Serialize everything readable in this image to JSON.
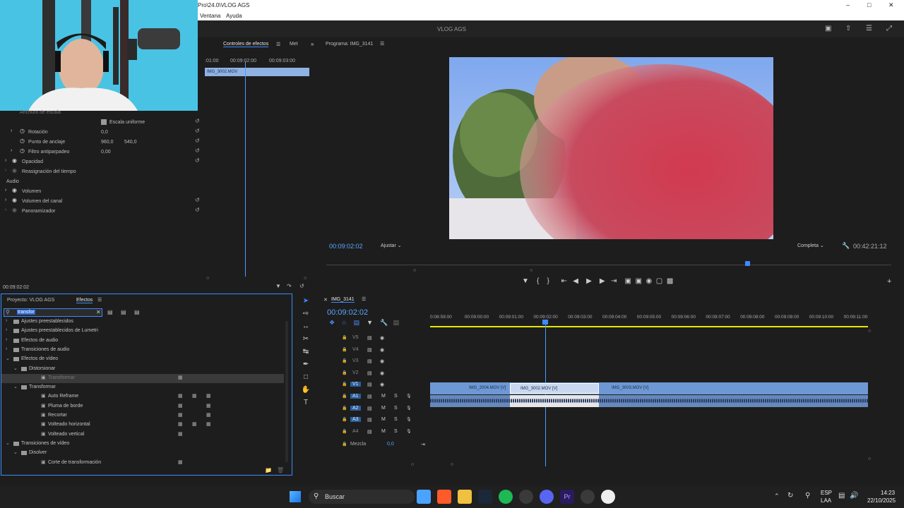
{
  "window": {
    "title_fragment": "Pro\\24.0\\VLOG AGS",
    "menu": [
      "Ventana",
      "Ayuda"
    ],
    "workspace_title": "VLOG AGS"
  },
  "effect_controls": {
    "tabs": [
      "Controles de efectos",
      "Met"
    ],
    "clip_name": "IMG_3002.MOV",
    "ruler": [
      ":01:00",
      "00:09:02:00",
      "00:09:03:00"
    ],
    "properties": [
      {
        "label": "Anchura de escala",
        "value": "",
        "value2": ""
      },
      {
        "label": "Escala uniforme",
        "value": "",
        "value2": ""
      },
      {
        "label": "Rotación",
        "value": "0,0",
        "value2": ""
      },
      {
        "label": "Punto de anclaje",
        "value": "960,0",
        "value2": "540,0"
      },
      {
        "label": "Filtro antiparpadeo",
        "value": "0,00",
        "value2": ""
      },
      {
        "label": "Opacidad",
        "value": "",
        "value2": ""
      },
      {
        "label": "Reasignación del tiempo",
        "value": "",
        "value2": ""
      },
      {
        "label": "Audio",
        "value": "",
        "value2": ""
      },
      {
        "label": "Volumen",
        "value": "",
        "value2": ""
      },
      {
        "label": "Volumen del canal",
        "value": "",
        "value2": ""
      },
      {
        "label": "Panoramizador",
        "value": "",
        "value2": ""
      }
    ],
    "timecode": "00:09:02:02"
  },
  "program_monitor": {
    "title": "Programa: IMG_3141",
    "timecode": "00:09:02:02",
    "fit": "Ajustar",
    "quality": "Completa",
    "duration": "00:42:21:12"
  },
  "project_panel": {
    "tabs": [
      "Proyecto: VLOG AGS",
      "Efectos"
    ],
    "search_value": "transfor",
    "tree": [
      {
        "label": "Ajustes preestablecidos",
        "level": 0
      },
      {
        "label": "Ajustes preestablecidos de Lumetri",
        "level": 0
      },
      {
        "label": "Efectos de audio",
        "level": 0
      },
      {
        "label": "Transiciones de audio",
        "level": 0
      },
      {
        "label": "Efectos de vídeo",
        "level": 0
      },
      {
        "label": "Distorsionar",
        "level": 1
      },
      {
        "label": "Transformar",
        "level": 2
      },
      {
        "label": "Transformar",
        "level": 1
      },
      {
        "label": "Auto Reframe",
        "level": 2
      },
      {
        "label": "Pluma de borde",
        "level": 2
      },
      {
        "label": "Recortar",
        "level": 2
      },
      {
        "label": "Volteado horizontal",
        "level": 2
      },
      {
        "label": "Volteado vertical",
        "level": 2
      },
      {
        "label": "Transiciones de vídeo",
        "level": 0
      },
      {
        "label": "Disolver",
        "level": 1
      },
      {
        "label": "Corte de transformación",
        "level": 2
      }
    ]
  },
  "timeline": {
    "sequence": "IMG_3141",
    "timecode": "00:09:02:02",
    "ruler": [
      "0:08:59:00",
      "00:09:00:00",
      "00:09:01:00",
      "00:09:02:00",
      "00:09:03:00",
      "00:09:04:00",
      "00:09:05:00",
      "00:09:06:00",
      "00:09:07:00",
      "00:09:08:00",
      "00:09:09:00",
      "00:09:10:00",
      "00:09:11:00"
    ],
    "video_tracks": [
      "V5",
      "V4",
      "V3",
      "V2",
      "V1"
    ],
    "audio_tracks": [
      "A1",
      "A2",
      "A3",
      "A4"
    ],
    "mix_label": "Mezcla",
    "mix_value": "0,0",
    "clips": [
      "IMG_2004.MOV [V]",
      "IMG_3002.MOV [V]",
      "IMG_3003.MOV [V]"
    ],
    "ms": [
      "M",
      "S"
    ]
  },
  "taskbar": {
    "search_label": "Buscar",
    "lang": "ESP",
    "lang2": "LAA",
    "time": "14:23",
    "date": "22/10/2025"
  }
}
